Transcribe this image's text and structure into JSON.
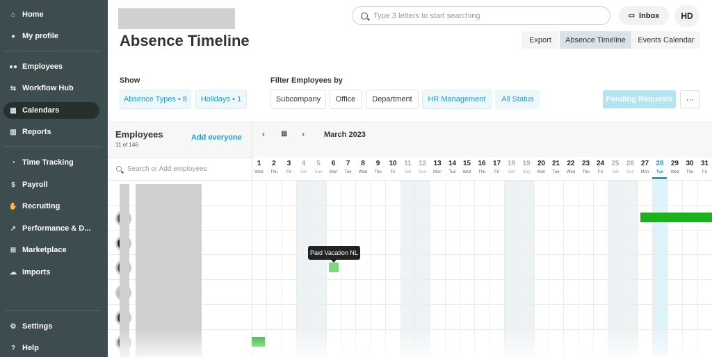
{
  "sidebar": {
    "items": [
      {
        "label": "Home",
        "icon": "home-icon"
      },
      {
        "label": "My profile",
        "icon": "user-icon"
      },
      {
        "label": "Employees",
        "icon": "users-icon"
      },
      {
        "label": "Workflow Hub",
        "icon": "workflow-icon"
      },
      {
        "label": "Calendars",
        "icon": "calendar-icon",
        "active": true
      },
      {
        "label": "Reports",
        "icon": "chart-icon"
      },
      {
        "label": "Time Tracking",
        "icon": "clock-icon"
      },
      {
        "label": "Payroll",
        "icon": "dollar-icon"
      },
      {
        "label": "Recruiting",
        "icon": "handshake-icon"
      },
      {
        "label": "Performance & D...",
        "icon": "trend-icon"
      },
      {
        "label": "Marketplace",
        "icon": "grid-icon"
      },
      {
        "label": "Imports",
        "icon": "cloud-upload-icon"
      },
      {
        "label": "Settings",
        "icon": "gear-icon"
      },
      {
        "label": "Help",
        "icon": "question-icon"
      }
    ]
  },
  "header": {
    "title": "Absence Timeline",
    "search_placeholder": "Type 3 letters to start searching",
    "inbox_label": "Inbox",
    "avatar_initials": "HD",
    "views": [
      "Export",
      "Absence Timeline",
      "Events Calendar"
    ],
    "active_view": "Absence Timeline"
  },
  "filters": {
    "show_label": "Show",
    "absence_types": "Absence Types • 8",
    "holidays": "Holidays • 1",
    "filter_label": "Filter Employees by",
    "subcompany": "Subcompany",
    "office": "Office",
    "department": "Department",
    "hr_management": "HR Management",
    "status": "All Status",
    "pending": "Pending Requests",
    "more": "···"
  },
  "employees_panel": {
    "title": "Employees",
    "count": "11 of 146",
    "add_everyone": "Add everyone",
    "search_placeholder": "Search or Add employees"
  },
  "calendar": {
    "month": "March 2023",
    "days": [
      {
        "d": "1",
        "w": "Wed"
      },
      {
        "d": "2",
        "w": "Thu"
      },
      {
        "d": "3",
        "w": "Fri"
      },
      {
        "d": "4",
        "w": "Sat",
        "we": true
      },
      {
        "d": "5",
        "w": "Sun",
        "we": true
      },
      {
        "d": "6",
        "w": "Mon"
      },
      {
        "d": "7",
        "w": "Tue"
      },
      {
        "d": "8",
        "w": "Wed"
      },
      {
        "d": "9",
        "w": "Thu"
      },
      {
        "d": "10",
        "w": "Fri"
      },
      {
        "d": "11",
        "w": "Sat",
        "we": true
      },
      {
        "d": "12",
        "w": "Sun",
        "we": true
      },
      {
        "d": "13",
        "w": "Mon"
      },
      {
        "d": "14",
        "w": "Tue"
      },
      {
        "d": "15",
        "w": "Wed"
      },
      {
        "d": "16",
        "w": "Thu"
      },
      {
        "d": "17",
        "w": "Fri"
      },
      {
        "d": "18",
        "w": "Sat",
        "we": true
      },
      {
        "d": "19",
        "w": "Sun",
        "we": true
      },
      {
        "d": "20",
        "w": "Mon"
      },
      {
        "d": "21",
        "w": "Tue"
      },
      {
        "d": "22",
        "w": "Wed"
      },
      {
        "d": "23",
        "w": "Thu"
      },
      {
        "d": "24",
        "w": "Fri"
      },
      {
        "d": "25",
        "w": "Sat",
        "we": true
      },
      {
        "d": "26",
        "w": "Sun",
        "we": true
      },
      {
        "d": "27",
        "w": "Mon"
      },
      {
        "d": "28",
        "w": "Tue",
        "today": true
      },
      {
        "d": "29",
        "w": "Wed"
      },
      {
        "d": "30",
        "w": "Thu"
      },
      {
        "d": "31",
        "w": "Fri"
      }
    ]
  },
  "tooltip": "Paid Vacation NL",
  "colors": {
    "accent": "#1a9fc9",
    "sidebar": "#3d4c4f",
    "absence": "#1ab31e"
  }
}
